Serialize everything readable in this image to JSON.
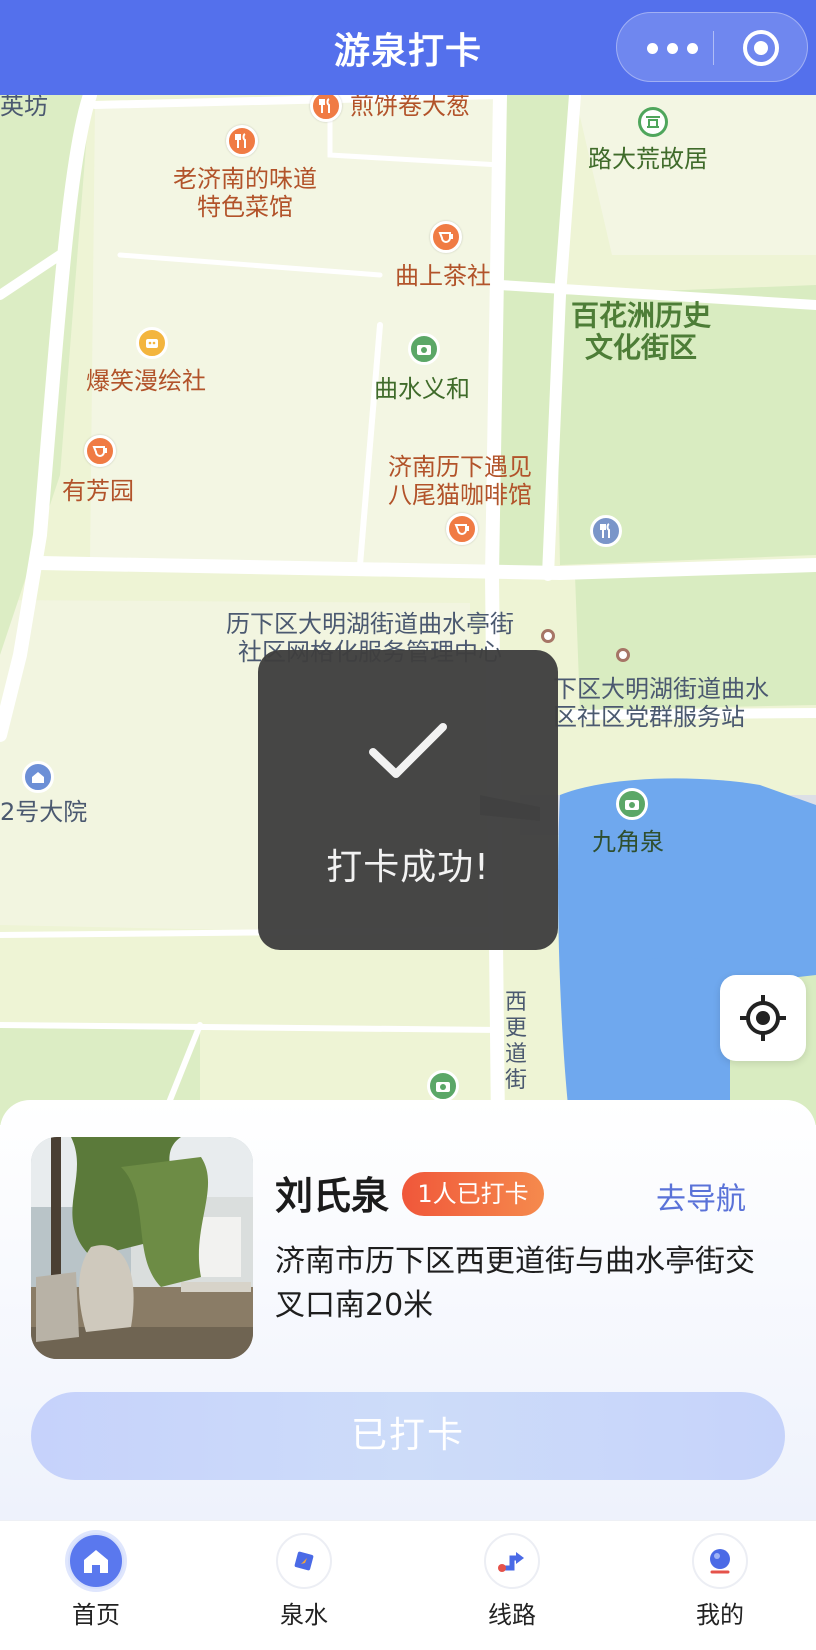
{
  "header": {
    "title": "游泉打卡"
  },
  "map": {
    "labels": {
      "yingfang": "英坊",
      "jianbing": "煎饼卷大葱",
      "laojinan_1": "老济南的味道",
      "laojinan_2": "特色菜馆",
      "ludahuang": "路大荒故居",
      "qushang": "曲上茶社",
      "baihuazhou_1": "百花洲历史",
      "baihuazhou_2": "文化街区",
      "baoxiao": "爆笑漫绘社",
      "qushui": "曲水义和",
      "jinan_cafe_1": "济南历下遇见",
      "jinan_cafe_2": "八尾猫咖啡馆",
      "youfang": "有芳园",
      "daminghu_1": "历下区大明湖街道曲水亭街",
      "daminghu_2": "社区网格化服务管理中心",
      "dangqun_1": "下区大明湖街道曲水",
      "dangqun_2": "区社区党群服务站",
      "dayuan": "2号大院",
      "jiujiao": "九角泉",
      "xigeng": "西更道街"
    }
  },
  "toast": {
    "text": "打卡成功!"
  },
  "card": {
    "name": "刘氏泉",
    "badge": "1人已打卡",
    "nav_label": "去导航",
    "address": "济南市历下区西更道街与曲水亭街交叉口南20米",
    "button_label": "已打卡"
  },
  "tabbar": {
    "items": [
      {
        "label": "首页",
        "icon": "home-icon"
      },
      {
        "label": "泉水",
        "icon": "compass-icon"
      },
      {
        "label": "线路",
        "icon": "route-icon"
      },
      {
        "label": "我的",
        "icon": "profile-icon"
      }
    ]
  },
  "colors": {
    "accent": "#5470ec",
    "badge": "#f0573a",
    "water": "#6fa8ee",
    "map_bg": "#eef4d5"
  }
}
